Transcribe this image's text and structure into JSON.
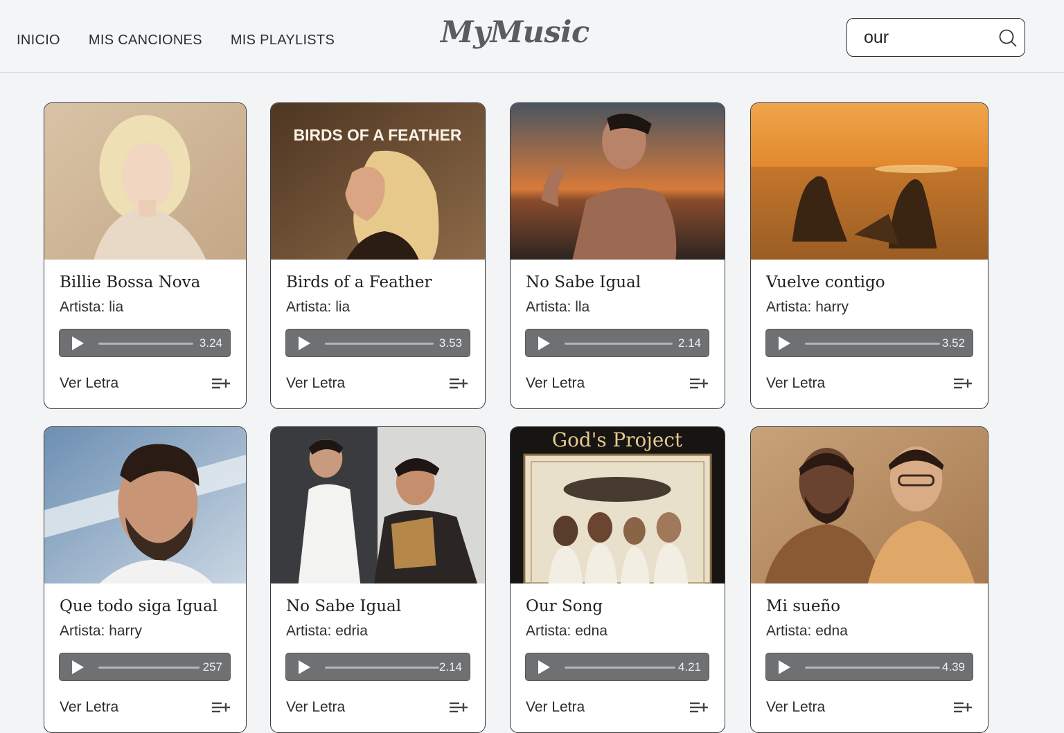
{
  "header": {
    "nav": [
      "INICIO",
      "MIS CANCIONES",
      "MIS PLAYLISTS"
    ],
    "logo": "MyMusic",
    "search_value": "our"
  },
  "card_labels": {
    "artist_prefix": "Artista: ",
    "lyrics": "Ver Letra"
  },
  "songs": [
    {
      "title": "Billie Bossa Nova",
      "artist": "lia",
      "duration": "3.24",
      "art": "portrait-blonde-woman",
      "art_text": ""
    },
    {
      "title": "Birds of a Feather",
      "artist": "lia",
      "duration": "3.53",
      "art": "blonde-singer-profile",
      "art_text": "BIRDS OF A FEATHER"
    },
    {
      "title": "No Sabe Igual",
      "artist": "lla",
      "duration": "2.14",
      "art": "man-at-sunset-sea",
      "art_text": ""
    },
    {
      "title": "Vuelve contigo",
      "artist": "harry",
      "duration": "3.52",
      "art": "couple-silhouette-beach",
      "art_text": ""
    },
    {
      "title": "Que todo siga Igual",
      "artist": "harry",
      "duration": "257",
      "art": "bearded-man-portrait",
      "art_text": ""
    },
    {
      "title": "No Sabe Igual",
      "artist": "edria",
      "duration": "2.14",
      "art": "two-men-performing",
      "art_text": ""
    },
    {
      "title": "Our Song",
      "artist": "edna",
      "duration": "4.21",
      "art": "vintage-album-cover",
      "art_text": "God's Project"
    },
    {
      "title": "Mi sueño",
      "artist": "edna",
      "duration": "4.39",
      "art": "two-men-vintage-photo",
      "art_text": ""
    }
  ],
  "colors": {
    "background": "#f3f4f5",
    "player": "#6e7072",
    "card_border": "#3a3a3a"
  }
}
